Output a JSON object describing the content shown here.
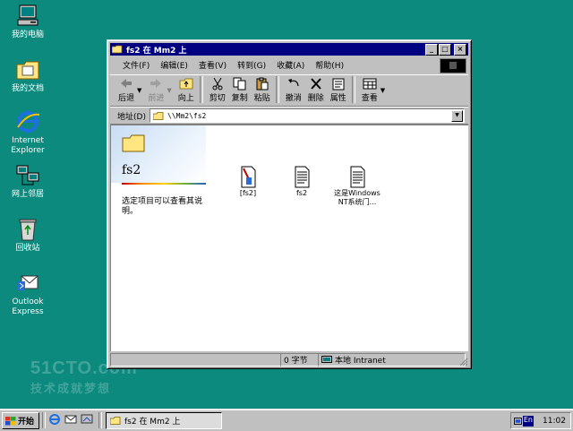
{
  "desktop": {
    "icons": [
      {
        "label": "我的电脑"
      },
      {
        "label": "我的文档"
      },
      {
        "label": "Internet Explorer"
      },
      {
        "label": "网上邻居"
      },
      {
        "label": "回收站"
      },
      {
        "label": "Outlook Express"
      }
    ]
  },
  "window": {
    "title": "fs2 在 Mm2 上",
    "menu": [
      "文件(F)",
      "编辑(E)",
      "查看(V)",
      "转到(G)",
      "收藏(A)",
      "帮助(H)"
    ],
    "toolbar": {
      "back": "后退",
      "forward": "前进",
      "up": "向上",
      "cut": "剪切",
      "copy": "复制",
      "paste": "粘贴",
      "undo": "撤消",
      "delete": "删除",
      "properties": "属性",
      "views": "查看"
    },
    "address": {
      "label": "地址(D)",
      "value": "\\\\Mm2\\fs2"
    },
    "webview": {
      "folder_title": "fs2",
      "hint": "选定项目可以查看其说明。"
    },
    "files": [
      {
        "name": "[fs2]"
      },
      {
        "name": "fs2"
      },
      {
        "name": "这是Windows NT系统门..."
      }
    ],
    "status": {
      "size": "0 字节",
      "zone": "本地 Intranet"
    }
  },
  "watermark": {
    "line1": "51CTO.com",
    "line2": "技术成就梦想"
  },
  "taskbar": {
    "start_label": "开始",
    "task_label": "fs2 在 Mm2 上",
    "lang": "En",
    "clock": "11:02"
  },
  "colors": {
    "desktop": "#0c8a7e",
    "titlebar": "#000080",
    "face": "#c0c0c0"
  }
}
